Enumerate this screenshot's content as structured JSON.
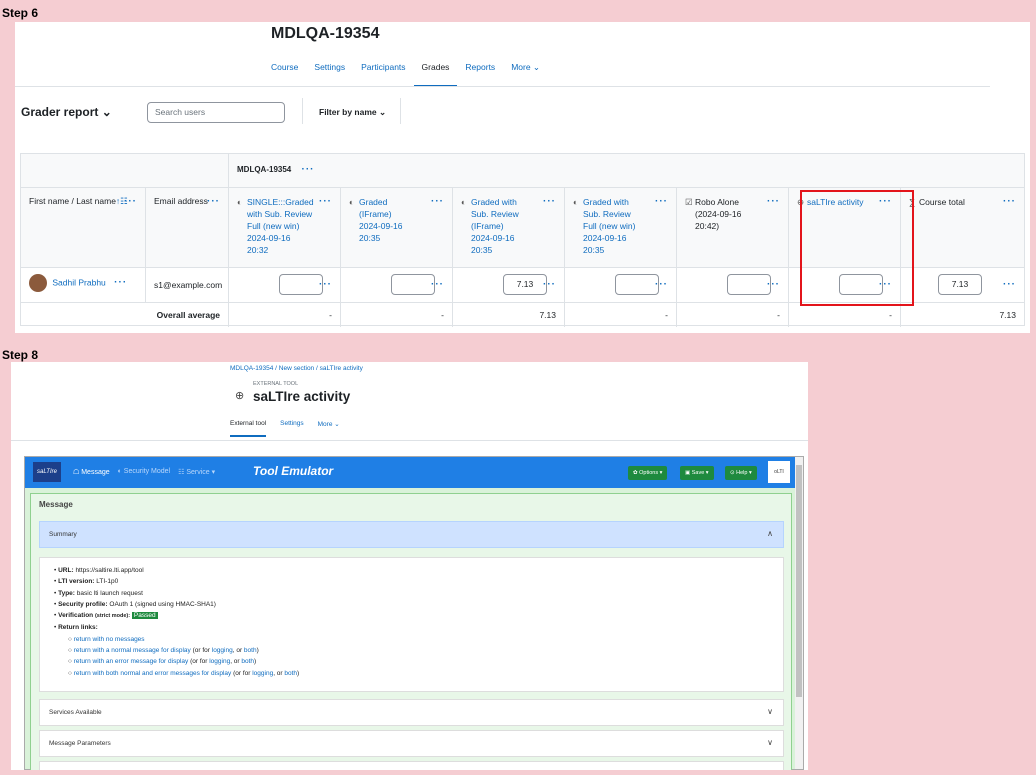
{
  "step6": {
    "label": "Step 6",
    "course_title": "MDLQA-19354",
    "nav": [
      "Course",
      "Settings",
      "Participants",
      "Grades",
      "Reports",
      "More ⌄"
    ],
    "nav_active": 3,
    "grader_title": "Grader report ⌄",
    "search_placeholder": "Search users",
    "filter_label": "Filter by name ⌄",
    "category_title": "MDLQA-19354",
    "col_name": "First name / Last name",
    "col_email": "Email address",
    "columns": [
      {
        "icon": "◐",
        "lines": [
          "SINGLE:::Graded",
          "with Sub. Review",
          "Full (new win)",
          "2024-09-16",
          "20:32"
        ],
        "link": true
      },
      {
        "icon": "◐",
        "lines": [
          "Graded",
          "(IFrame)",
          "2024-09-16",
          "20:35"
        ],
        "link": true
      },
      {
        "icon": "◐",
        "lines": [
          "Graded with",
          "Sub. Review",
          "(IFrame)",
          "2024-09-16",
          "20:35"
        ],
        "link": true
      },
      {
        "icon": "◐",
        "lines": [
          "Graded with",
          "Sub. Review",
          "Full (new win)",
          "2024-09-16",
          "20:35"
        ],
        "link": true
      },
      {
        "icon": "☑",
        "lines": [
          "Robo Alone",
          "(2024-09-16",
          "20:42)"
        ],
        "link": false
      },
      {
        "icon": "⊕",
        "lines": [
          "saLTIre activity"
        ],
        "link": true
      },
      {
        "icon": "∑",
        "lines": [
          "Course total"
        ],
        "link": false
      }
    ],
    "student_name": "Sadhil Prabhu",
    "student_email": "s1@example.com",
    "grades": [
      "",
      "",
      "7.13",
      "",
      "",
      "",
      "7.13"
    ],
    "overall_label": "Overall average",
    "averages": [
      "-",
      "-",
      "7.13",
      "-",
      "-",
      "-",
      "7.13"
    ]
  },
  "step8": {
    "label": "Step 8",
    "breadcrumb": "MDLQA-19354 / New section / saLTIre activity",
    "tool_type": "EXTERNAL TOOL",
    "title": "saLTIre activity",
    "tabs": [
      "External tool",
      "Settings",
      "More ⌄"
    ],
    "emu_logo": "saLTIre",
    "emu_nav": [
      "☖ Message",
      "◐ Security Model",
      "☷ Service ▾"
    ],
    "emu_title": "Tool Emulator",
    "btn_options": "✿ Options ▾",
    "btn_save": "▣ Save ▾",
    "btn_help": "⊙ Help ▾",
    "lti_icon": "oLTI",
    "message_header": "Message",
    "summary_title": "Summary",
    "summary": {
      "url_label": "URL:",
      "url": "https://saltire.lti.app/tool",
      "lti_label": "LTI version:",
      "lti": "LTI-1p0",
      "type_label": "Type:",
      "type": "basic lti launch request",
      "sec_label": "Security profile:",
      "sec": "OAuth 1 (signed using HMAC-SHA1)",
      "ver_label": "Verification",
      "ver_mode": "(strict mode):",
      "ver": "Passed",
      "ret_label": "Return links:",
      "links": [
        {
          "a": "return with no messages",
          "b": "",
          "c": "",
          "d": "",
          "e": ""
        },
        {
          "a": "return with a normal message for display",
          "b": " (or for ",
          "c": "logging",
          "d": ", or ",
          "e": "both"
        },
        {
          "a": "return with an error message for display",
          "b": " (or for ",
          "c": "logging",
          "d": ", or ",
          "e": "both"
        },
        {
          "a": "return with both normal and error messages for display",
          "b": " (or for ",
          "c": "logging",
          "d": ", or ",
          "e": "both"
        }
      ]
    },
    "services_title": "Services Available",
    "params_title": "Message Parameters"
  },
  "colors": {
    "accent": "#0f6cbf",
    "background": "#f5cdd2",
    "highlight": "#e3141b",
    "emulator_bar": "#1f7fe5",
    "success": "#1e8a3e"
  }
}
